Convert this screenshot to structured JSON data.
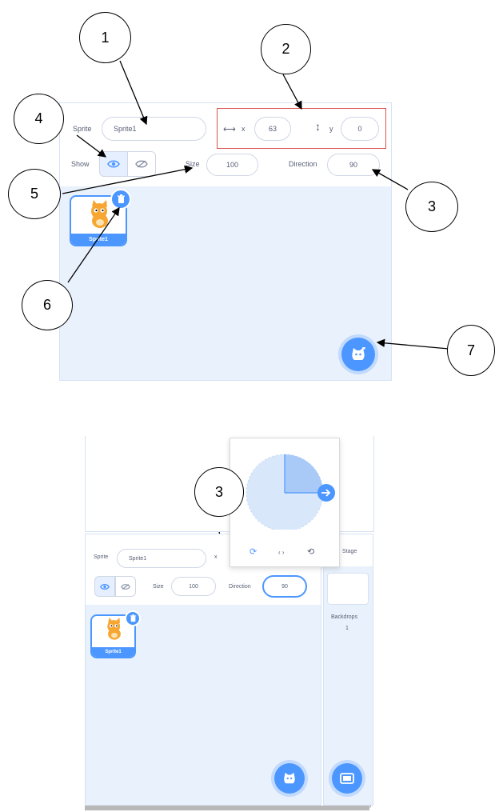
{
  "top": {
    "sprite_label": "Sprite",
    "sprite_name": "Sprite1",
    "x_label": "x",
    "x_value": "63",
    "y_label": "y",
    "y_value": "0",
    "show_label": "Show",
    "size_label": "Size",
    "size_value": "100",
    "direction_label": "Direction",
    "direction_value": "90",
    "tile_name": "Sprite1"
  },
  "bottom": {
    "sprite_label": "Sprite",
    "sprite_name": "Sprite1",
    "size_label": "Size",
    "size_value": "100",
    "direction_label": "Direction",
    "direction_value": "90",
    "tile_name": "Sprite1",
    "stage_label": "Stage",
    "backdrops_label": "Backdrops",
    "backdrops_count": "1",
    "dial_left_label": "‹ ›",
    "x_fragment": "x"
  },
  "callouts": [
    "1",
    "2",
    "3",
    "4",
    "5",
    "6",
    "7",
    "3"
  ],
  "colors": {
    "accent": "#4c97ff",
    "panel": "#e9f1fc",
    "highlight_box": "#d9534f"
  }
}
